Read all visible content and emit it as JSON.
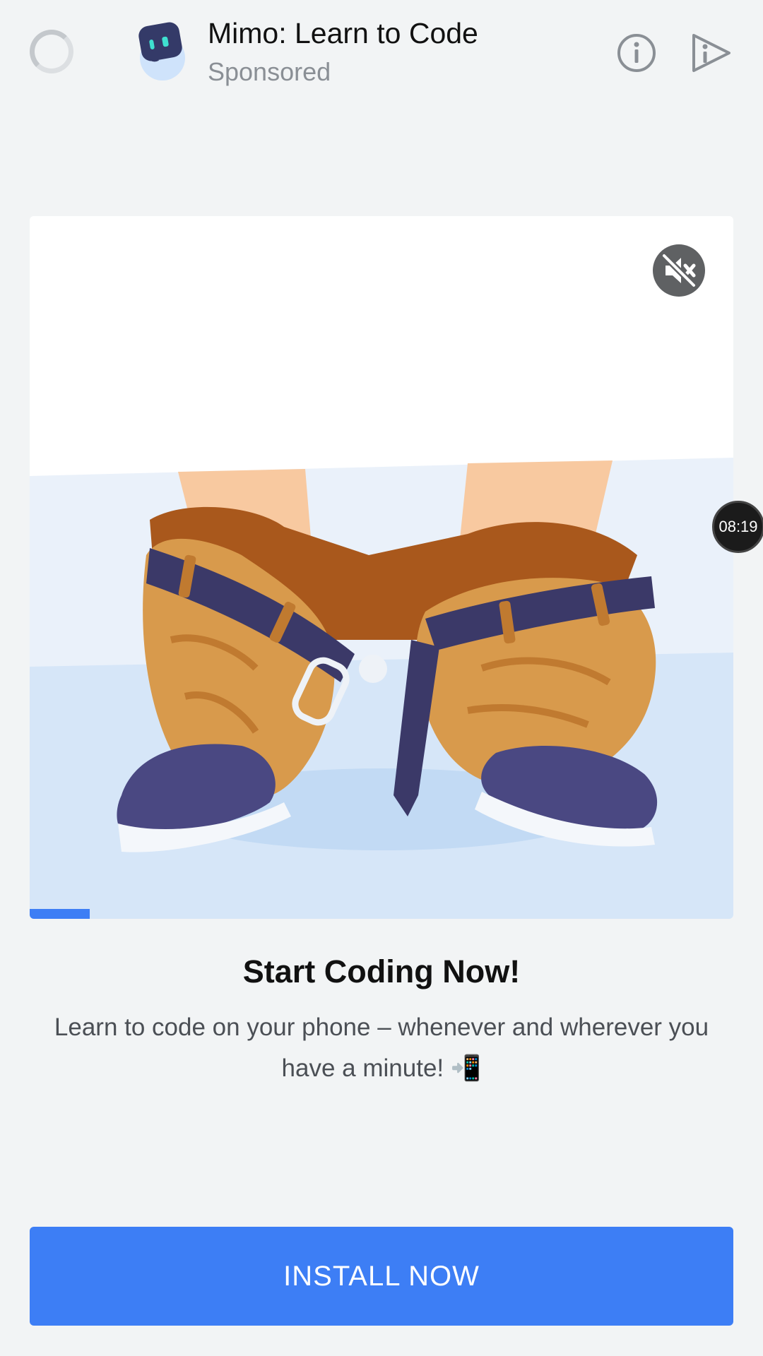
{
  "header": {
    "app_title": "Mimo: Learn to Code",
    "sponsored_label": "Sponsored",
    "icons": [
      "loading-spinner-icon",
      "app-logo-icon",
      "info-icon",
      "adchoices-icon"
    ]
  },
  "media": {
    "mute_icon": "muted-speaker-icon",
    "progress": 0.085,
    "timer": "08:19"
  },
  "ad": {
    "headline": "Start Coding Now!",
    "body": "Learn to code on your phone – whenever and wherever you have a minute! 📲"
  },
  "cta": {
    "label": "INSTALL NOW"
  },
  "colors": {
    "accent": "#3d7ef5",
    "background": "#f2f4f5"
  }
}
